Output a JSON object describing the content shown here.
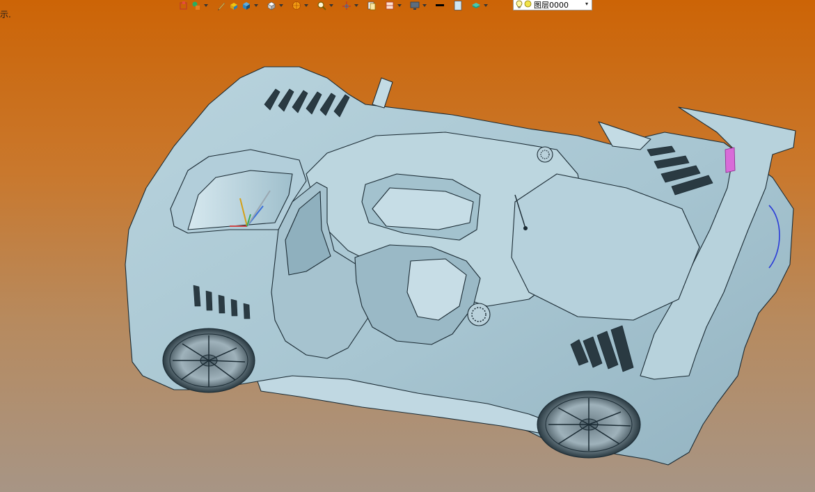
{
  "status": {
    "hint_text": "示."
  },
  "layer_selector": {
    "current_layer": "图层0000"
  },
  "toolbar": {
    "icons": [
      "sketch-icon",
      "shapes-icon",
      "pencil-icon",
      "extrude-icon",
      "box-icon",
      "cube-view-icon",
      "render-style-icon",
      "zoom-icon",
      "axis-icon",
      "copy-icon",
      "section-icon",
      "display-icon",
      "line-width-icon",
      "color-swatch-icon",
      "layer-stack-icon"
    ]
  },
  "colors": {
    "background_top": "#cc6406",
    "background_bottom": "#a79585",
    "model_fill": "#a9c7d3",
    "model_stroke": "#1a2a33"
  }
}
